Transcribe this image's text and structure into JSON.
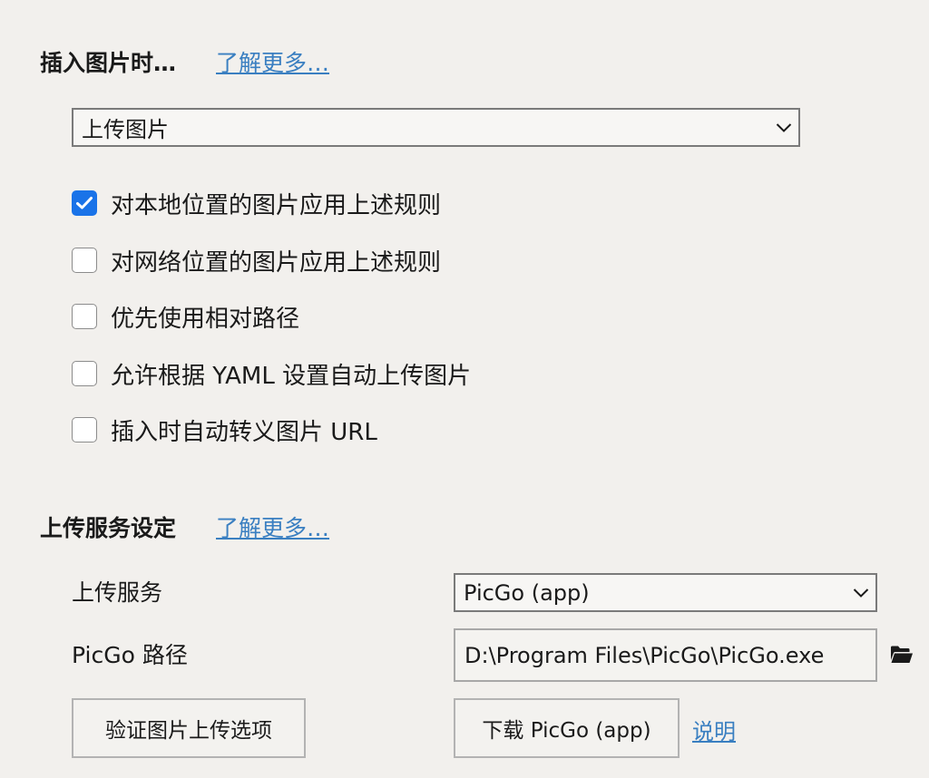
{
  "image_section": {
    "title": "插入图片时…",
    "learn_more": "了解更多…",
    "insert_action": {
      "selected": "上传图片"
    },
    "options": [
      {
        "label": "对本地位置的图片应用上述规则",
        "checked": true
      },
      {
        "label": "对网络位置的图片应用上述规则",
        "checked": false
      },
      {
        "label": "优先使用相对路径",
        "checked": false
      },
      {
        "label": "允许根据 YAML 设置自动上传图片",
        "checked": false
      },
      {
        "label": "插入时自动转义图片 URL",
        "checked": false
      }
    ]
  },
  "upload_section": {
    "title": "上传服务设定",
    "learn_more": "了解更多…",
    "service_label": "上传服务",
    "service_selected": "PicGo (app)",
    "path_label": "PicGo 路径",
    "path_value": "D:\\Program Files\\PicGo\\PicGo.exe",
    "verify_button": "验证图片上传选项",
    "download_button": "下载 PicGo (app)",
    "help_link": "说明"
  },
  "icons": {
    "chevron": "chevron-down-icon",
    "check": "checkmark-icon",
    "folder": "folder-open-icon"
  },
  "colors": {
    "background": "#f2f0ed",
    "link": "#3a7fc1",
    "checkbox_checked": "#1a73e8"
  }
}
